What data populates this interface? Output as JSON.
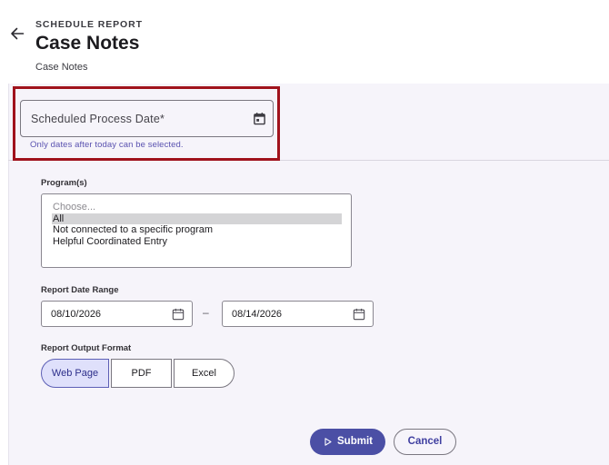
{
  "header": {
    "eyebrow": "SCHEDULE REPORT",
    "title": "Case Notes",
    "subtitle": "Case Notes"
  },
  "scheduled_date": {
    "placeholder": "Scheduled Process Date*",
    "value": "",
    "hint": "Only dates after today can be selected."
  },
  "programs": {
    "label": "Program(s)",
    "options": [
      {
        "label": "Choose...",
        "selected": false
      },
      {
        "label": "All",
        "selected": true
      },
      {
        "label": "Not connected to a specific program",
        "selected": false
      },
      {
        "label": "Helpful Coordinated Entry",
        "selected": false
      }
    ]
  },
  "report_date_range": {
    "label": "Report Date Range",
    "start": "08/10/2026",
    "separator": "–",
    "end": "08/14/2026"
  },
  "output_format": {
    "label": "Report Output Format",
    "options": [
      "Web Page",
      "PDF",
      "Excel"
    ],
    "selected": "Web Page"
  },
  "actions": {
    "submit_label": "Submit",
    "cancel_label": "Cancel"
  },
  "colors": {
    "primary": "#4b4fa5",
    "selected_segment_bg": "#dfe0fb",
    "highlight_border": "#a0121c",
    "hint_text": "#5a52b0",
    "panel_bg": "#f6f4fa"
  },
  "icons": {
    "back": "arrow-left-icon",
    "calendar": "calendar-icon",
    "submit": "play-icon"
  }
}
